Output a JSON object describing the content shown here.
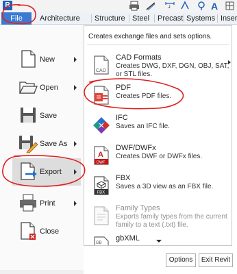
{
  "app": {
    "logo_letter": "R"
  },
  "tabs": [
    {
      "label": "File"
    },
    {
      "label": "Architecture"
    },
    {
      "label": "Structure"
    },
    {
      "label": "Steel"
    },
    {
      "label": "Precast"
    },
    {
      "label": "Systems"
    },
    {
      "label": "Insert"
    }
  ],
  "app_menu": {
    "items": [
      {
        "label": "New",
        "icon": "new-file-icon",
        "has_submenu": true
      },
      {
        "label": "Open",
        "icon": "open-folder-icon",
        "has_submenu": true
      },
      {
        "label": "Save",
        "icon": "save-icon",
        "has_submenu": false
      },
      {
        "label": "Save As",
        "icon": "save-as-icon",
        "has_submenu": true
      },
      {
        "label": "Export",
        "icon": "export-icon",
        "has_submenu": true,
        "active": true
      },
      {
        "label": "Print",
        "icon": "printer-icon",
        "has_submenu": true
      },
      {
        "label": "Close",
        "icon": "close-document-icon",
        "has_submenu": false
      }
    ]
  },
  "flyout": {
    "header": "Creates exchange files and sets options.",
    "items": [
      {
        "title": "CAD Formats",
        "desc": "Creates DWG, DXF, DGN, OBJ, SAT, or STL files.",
        "icon": "cad-formats-icon",
        "has_submenu": true
      },
      {
        "title": "PDF",
        "desc": "Creates PDF files.",
        "icon": "pdf-icon"
      },
      {
        "title": "IFC",
        "desc": "Saves an IFC file.",
        "icon": "ifc-icon"
      },
      {
        "title": "DWF/DWFx",
        "desc": "Creates DWF or DWFx files.",
        "icon": "dwf-icon"
      },
      {
        "title": "FBX",
        "desc": "Saves a 3D view as an FBX file.",
        "icon": "fbx-icon"
      },
      {
        "title": "Family Types",
        "desc": "Exports family types from the current family to a text (.txt) file.",
        "icon": "family-types-icon",
        "disabled": true
      },
      {
        "title": "gbXML",
        "desc": "",
        "icon": "gbxml-icon"
      }
    ]
  },
  "buttons": {
    "options": "Options",
    "exit": "Exit Revit"
  },
  "colors": {
    "file_tab": "#3b7ad0",
    "annotation": "#e02020",
    "active_item": "#dddddd"
  }
}
